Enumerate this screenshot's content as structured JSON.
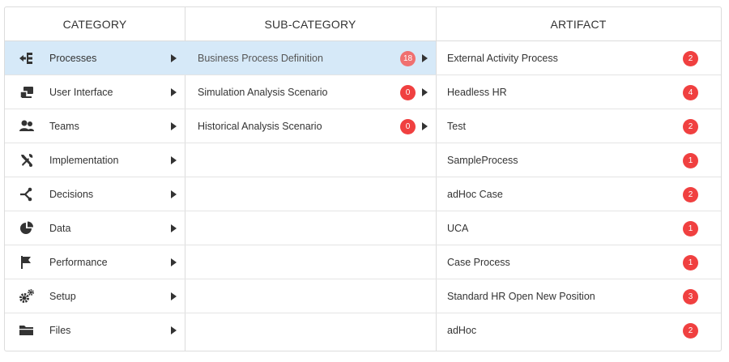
{
  "headers": {
    "category": "CATEGORY",
    "subcategory": "SUB-CATEGORY",
    "artifact": "ARTIFACT"
  },
  "categories": [
    {
      "label": "Processes",
      "icon": "processes-icon"
    },
    {
      "label": "User Interface",
      "icon": "user-interface-icon"
    },
    {
      "label": "Teams",
      "icon": "teams-icon"
    },
    {
      "label": "Implementation",
      "icon": "tools-icon"
    },
    {
      "label": "Decisions",
      "icon": "decisions-icon"
    },
    {
      "label": "Data",
      "icon": "pie-chart-icon"
    },
    {
      "label": "Performance",
      "icon": "flag-icon"
    },
    {
      "label": "Setup",
      "icon": "gears-icon"
    },
    {
      "label": "Files",
      "icon": "folder-icon"
    }
  ],
  "subcategories": [
    {
      "label": "Business Process Definition",
      "count": "18"
    },
    {
      "label": "Simulation Analysis Scenario",
      "count": "0"
    },
    {
      "label": "Historical Analysis Scenario",
      "count": "0"
    }
  ],
  "artifacts": [
    {
      "label": "External Activity Process",
      "count": "2"
    },
    {
      "label": "Headless HR",
      "count": "4"
    },
    {
      "label": "Test",
      "count": "2"
    },
    {
      "label": "SampleProcess",
      "count": "1"
    },
    {
      "label": "adHoc Case",
      "count": "2"
    },
    {
      "label": "UCA",
      "count": "1"
    },
    {
      "label": "Case Process",
      "count": "1"
    },
    {
      "label": "Standard HR Open New Position",
      "count": "3"
    },
    {
      "label": "adHoc",
      "count": "2"
    }
  ],
  "colors": {
    "selected_row": "#d6e9f8",
    "badge": "#f04040",
    "badge_selected": "#f07070"
  }
}
